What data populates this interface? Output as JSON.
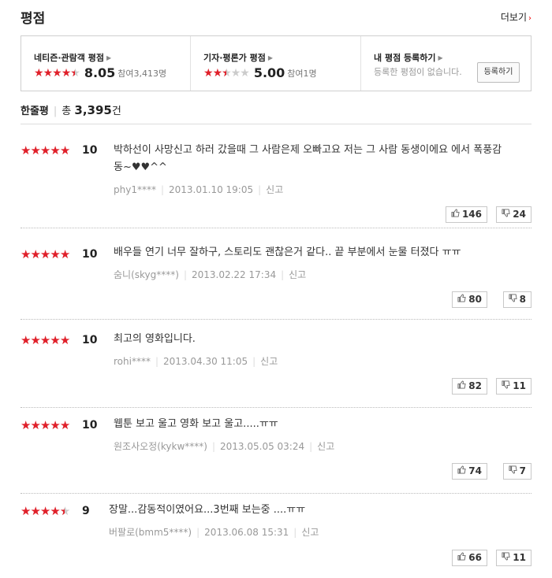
{
  "header": {
    "title": "평점",
    "more_label": "더보기"
  },
  "summary": {
    "netizen": {
      "label": "네티즌·관람객 평점",
      "score": "8.05",
      "participants": "참여3,413명",
      "stars": [
        2,
        2,
        2,
        2,
        1
      ]
    },
    "critic": {
      "label": "기자·평론가 평점",
      "score": "5.00",
      "participants": "참여1명",
      "stars": [
        2,
        2,
        1,
        0,
        0
      ]
    },
    "mine": {
      "label": "내 평점 등록하기",
      "desc": "등록한 평점이 없습니다.",
      "button": "등록하기"
    }
  },
  "oneline": {
    "heading": "한줄평",
    "total_label": "총",
    "count": "3,395",
    "unit": "건"
  },
  "reviews": [
    {
      "stars": 5,
      "score": "10",
      "text": "박하선이 사망신고 하러 갔을때 그 사람은제 오빠고요 저는 그 사람 동생이에요 에서 폭풍감동~♥♥^^",
      "user": "phy1****",
      "date": "2013.01.10 19:05",
      "report": "신고",
      "likes": "146",
      "dislikes": "24"
    },
    {
      "stars": 5,
      "score": "10",
      "text": "배우들 연기 너무 잘하구, 스토리도 괜찮은거 같다.. 끝 부분에서 눈물 터졌다 ㅠㅠ",
      "user": "숨니(skyg****)",
      "date": "2013.02.22 17:34",
      "report": "신고",
      "likes": "80",
      "dislikes": "8"
    },
    {
      "stars": 5,
      "score": "10",
      "text": "최고의 영화입니다.",
      "user": "rohi****",
      "date": "2013.04.30 11:05",
      "report": "신고",
      "likes": "82",
      "dislikes": "11"
    },
    {
      "stars": 5,
      "score": "10",
      "text": "웹툰 보고 울고 영화 보고 울고.....ㅠㅠ",
      "user": "원조사오정(kykw****)",
      "date": "2013.05.05 03:24",
      "report": "신고",
      "likes": "74",
      "dislikes": "7"
    },
    {
      "stars": 4.5,
      "score": "9",
      "text": "장말...감동적이였어요...3번째 보는중 ....ㅠㅠ",
      "user": "버팔로(bmm5****)",
      "date": "2013.06.08 15:31",
      "report": "신고",
      "likes": "66",
      "dislikes": "11"
    }
  ]
}
